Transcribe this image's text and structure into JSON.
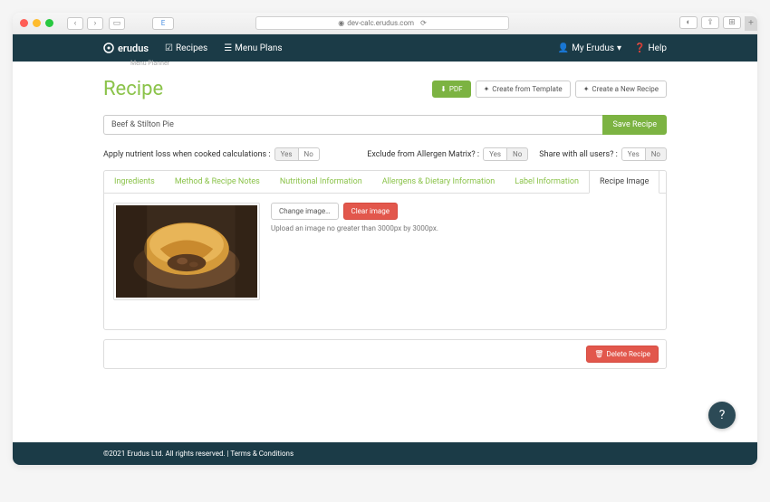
{
  "browser": {
    "url": "dev-calc.erudus.com",
    "tab_label": "E"
  },
  "nav": {
    "brand": "erudus",
    "brand_sub": "Menu Planner",
    "recipes": "Recipes",
    "menu_plans": "Menu Plans",
    "my_erudus": "My Erudus",
    "help": "Help"
  },
  "page": {
    "title": "Recipe"
  },
  "buttons": {
    "pdf": "PDF",
    "from_template": "Create from Template",
    "new_recipe": "Create a New Recipe",
    "save": "Save Recipe",
    "change_image": "Change image…",
    "clear_image": "Clear image",
    "delete": "Delete Recipe"
  },
  "recipe": {
    "name": "Beef & Stilton Pie"
  },
  "options": {
    "nutrient_loss_label": "Apply nutrient loss when cooked calculations :",
    "allergen_label": "Exclude from Allergen Matrix? :",
    "share_label": "Share with all users? :",
    "yes": "Yes",
    "no": "No"
  },
  "tabs": {
    "ingredients": "Ingredients",
    "method": "Method & Recipe Notes",
    "nutrition": "Nutritional Information",
    "allergens": "Allergens & Dietary Information",
    "label": "Label Information",
    "image": "Recipe Image"
  },
  "image_tab": {
    "hint": "Upload an image no greater than 3000px by 3000px."
  },
  "footer": {
    "copyright": "©2021 Erudus Ltd. All rights reserved. | ",
    "terms": "Terms & Conditions"
  }
}
